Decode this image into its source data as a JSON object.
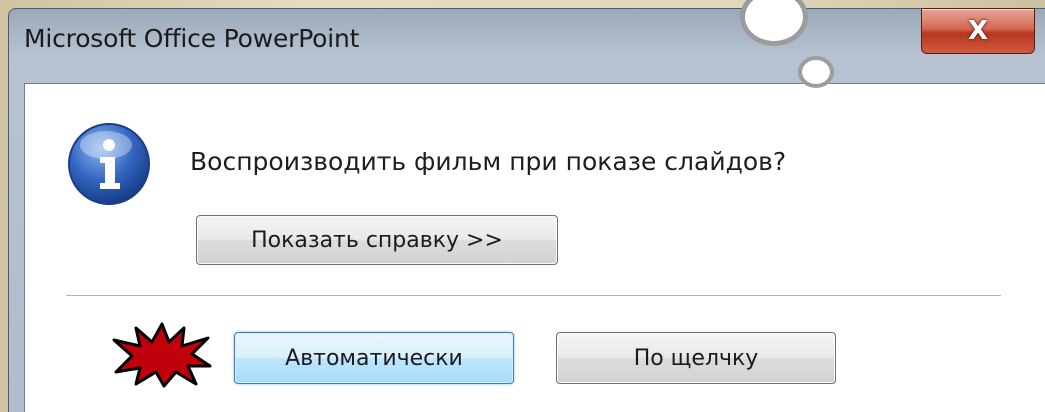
{
  "window": {
    "title": "Microsoft Office PowerPoint",
    "close_label": "X"
  },
  "dialog": {
    "icon": "info-icon",
    "message": "Воспроизводить фильм при показе слайдов?",
    "help_button_label": "Показать справку >>",
    "buttons": {
      "automatic_label": "Автоматически",
      "on_click_label": "По щелчку"
    }
  },
  "annotation": {
    "marker": "starburst-icon",
    "marker_color": "#c0000a"
  },
  "colors": {
    "close_button": "#c94a31",
    "default_button_border": "#3c7fb1",
    "info_icon_blue": "#2e5fb0"
  }
}
